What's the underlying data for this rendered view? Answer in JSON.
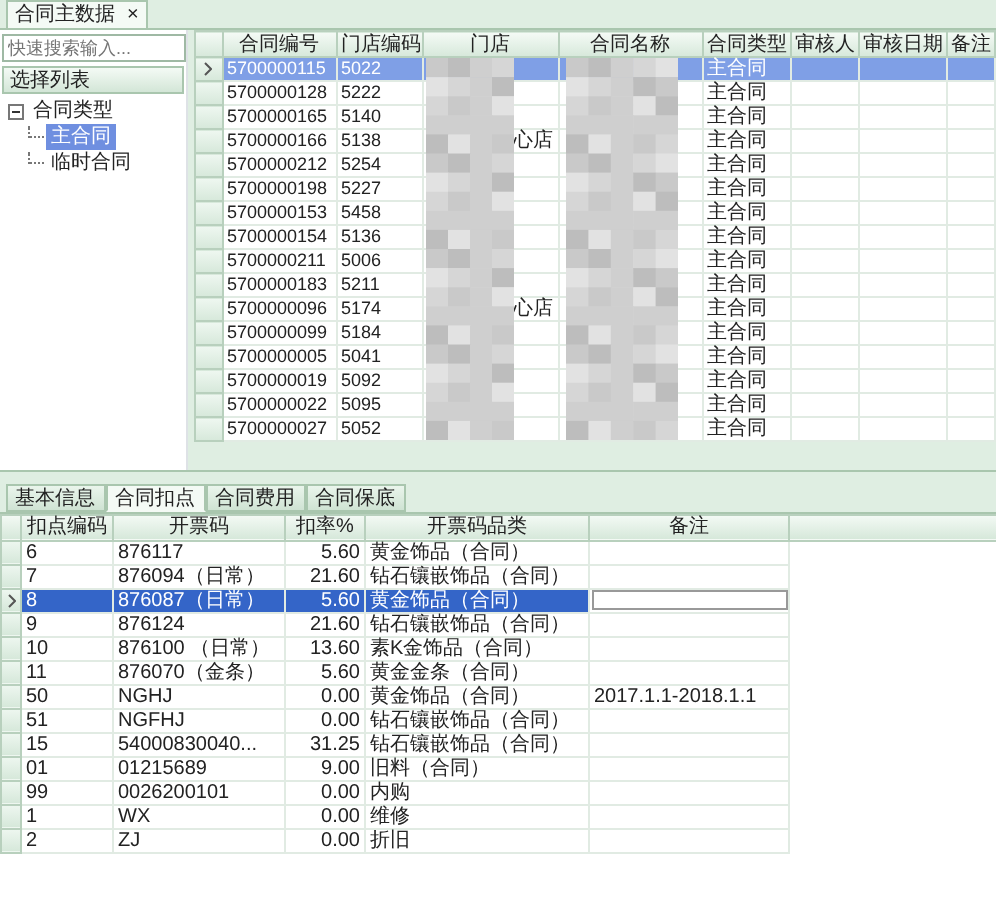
{
  "document_tab": {
    "title": "合同主数据",
    "close": "×"
  },
  "sidebar": {
    "search": {
      "placeholder": "快速搜索输入..."
    },
    "header": "选择列表",
    "tree": [
      {
        "label": "合同类型",
        "expanded": true,
        "children": [
          {
            "label": "主合同",
            "selected": true
          },
          {
            "label": "临时合同",
            "selected": false
          }
        ]
      }
    ]
  },
  "contracts": {
    "columns": [
      "合同编号",
      "门店编码",
      "门店",
      "合同名称",
      "合同类型",
      "审核人",
      "审核日期",
      "备注"
    ],
    "rows": [
      {
        "selected": true,
        "number": "5700000115",
        "store_code": "5022",
        "type": "主合同"
      },
      {
        "selected": false,
        "number": "5700000128",
        "store_code": "5222",
        "type": "主合同"
      },
      {
        "selected": false,
        "number": "5700000165",
        "store_code": "5140",
        "type": "主合同"
      },
      {
        "selected": false,
        "number": "5700000166",
        "store_code": "5138",
        "store": "心店",
        "type": "主合同"
      },
      {
        "selected": false,
        "number": "5700000212",
        "store_code": "5254",
        "type": "主合同"
      },
      {
        "selected": false,
        "number": "5700000198",
        "store_code": "5227",
        "type": "主合同"
      },
      {
        "selected": false,
        "number": "5700000153",
        "store_code": "5458",
        "type": "主合同"
      },
      {
        "selected": false,
        "number": "5700000154",
        "store_code": "5136",
        "type": "主合同"
      },
      {
        "selected": false,
        "number": "5700000211",
        "store_code": "5006",
        "type": "主合同"
      },
      {
        "selected": false,
        "number": "5700000183",
        "store_code": "5211",
        "type": "主合同"
      },
      {
        "selected": false,
        "number": "5700000096",
        "store_code": "5174",
        "store": "心店",
        "type": "主合同"
      },
      {
        "selected": false,
        "number": "5700000099",
        "store_code": "5184",
        "type": "主合同"
      },
      {
        "selected": false,
        "number": "5700000005",
        "store_code": "5041",
        "type": "主合同"
      },
      {
        "selected": false,
        "number": "5700000019",
        "store_code": "5092",
        "type": "主合同"
      },
      {
        "selected": false,
        "number": "5700000022",
        "store_code": "5095",
        "type": "主合同"
      },
      {
        "selected": false,
        "number": "5700000027",
        "store_code": "5052",
        "type": "主合同"
      }
    ]
  },
  "detail_tabs": [
    {
      "label": "基本信息",
      "selected": false
    },
    {
      "label": "合同扣点",
      "selected": true
    },
    {
      "label": "合同费用",
      "selected": false
    },
    {
      "label": "合同保底",
      "selected": false
    }
  ],
  "discounts": {
    "columns": [
      "扣点编码",
      "开票码",
      "扣率%",
      "开票码品类",
      "备注"
    ],
    "rows": [
      {
        "selected": false,
        "code": "6",
        "invoice_code": "876117",
        "rate": "5.60",
        "category": "黄金饰品（合同）"
      },
      {
        "selected": false,
        "code": "7",
        "invoice_code": "876094（日常）",
        "rate": "21.60",
        "category": "钻石镶嵌饰品（合同）"
      },
      {
        "selected": true,
        "code": "8",
        "invoice_code": "876087（日常）",
        "rate": "5.60",
        "category": "黄金饰品（合同）"
      },
      {
        "selected": false,
        "code": "9",
        "invoice_code": "876124",
        "rate": "21.60",
        "category": "钻石镶嵌饰品（合同）"
      },
      {
        "selected": false,
        "code": "10",
        "invoice_code": "876100 （日常）",
        "rate": "13.60",
        "category": "素K金饰品（合同）"
      },
      {
        "selected": false,
        "code": "11",
        "invoice_code": "876070（金条）",
        "rate": "5.60",
        "category": "黄金金条（合同）"
      },
      {
        "selected": false,
        "code": "50",
        "invoice_code": "NGHJ",
        "rate": "0.00",
        "category": "黄金饰品（合同）",
        "note": "2017.1.1-2018.1.1"
      },
      {
        "selected": false,
        "code": "51",
        "invoice_code": "NGFHJ",
        "rate": "0.00",
        "category": "钻石镶嵌饰品（合同）"
      },
      {
        "selected": false,
        "code": "15",
        "invoice_code": "54000830040...",
        "rate": "31.25",
        "category": "钻石镶嵌饰品（合同）"
      },
      {
        "selected": false,
        "code": "01",
        "invoice_code": "01215689",
        "rate": "9.00",
        "category": "旧料（合同）"
      },
      {
        "selected": false,
        "code": "99",
        "invoice_code": "0026200101",
        "rate": "0.00",
        "category": "内购"
      },
      {
        "selected": false,
        "code": "1",
        "invoice_code": "WX",
        "rate": "0.00",
        "category": "维修"
      },
      {
        "selected": false,
        "code": "2",
        "invoice_code": "ZJ",
        "rate": "0.00",
        "category": "折旧"
      }
    ]
  }
}
